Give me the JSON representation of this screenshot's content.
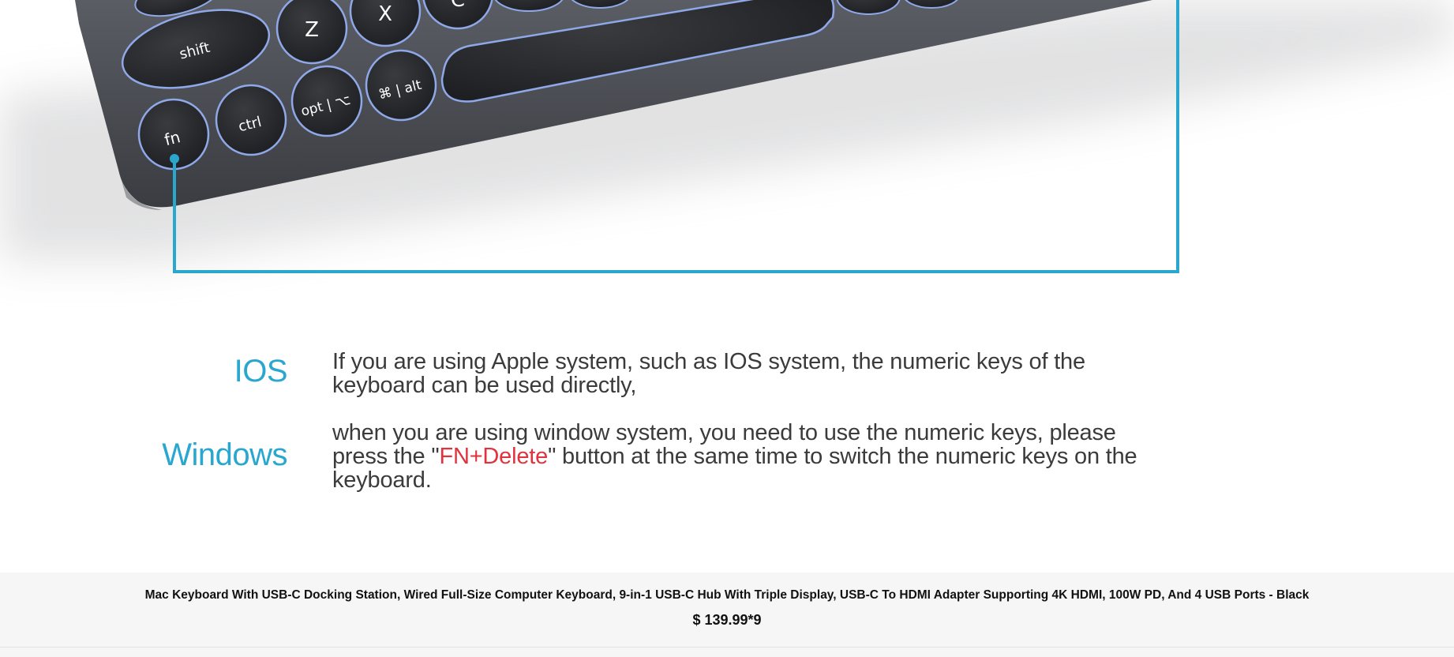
{
  "keyboard_image": {
    "keys": {
      "shift": "shift",
      "z": "Z",
      "x": "X",
      "c": "C",
      "fn": "fn",
      "ctrl": "ctrl",
      "opt": "opt | ⌥",
      "cmd": "⌘ | alt"
    }
  },
  "instructions": {
    "ios_label": "IOS",
    "ios_text": "If you are using Apple system, such as IOS system, the numeric keys of the keyboard can be used directly,",
    "windows_label": "Windows",
    "windows_text_before": "when you are using window system, you need to use the numeric keys, please press the \"",
    "windows_highlight": "FN+Delete",
    "windows_text_after": "\" button at the same time to switch the numeric keys on the keyboard."
  },
  "product": {
    "title": "Mac Keyboard With USB-C Docking Station, Wired Full-Size Computer Keyboard, 9-in-1 USB-C Hub With Triple Display, USB-C To HDMI Adapter Supporting 4K HDMI, 100W PD, And 4 USB Ports - Black",
    "price": "$ 139.99*9"
  },
  "colors": {
    "accent_blue": "#2aa7cf",
    "highlight_red": "#e0333d",
    "info_bar_bg": "#f6f6f6"
  }
}
